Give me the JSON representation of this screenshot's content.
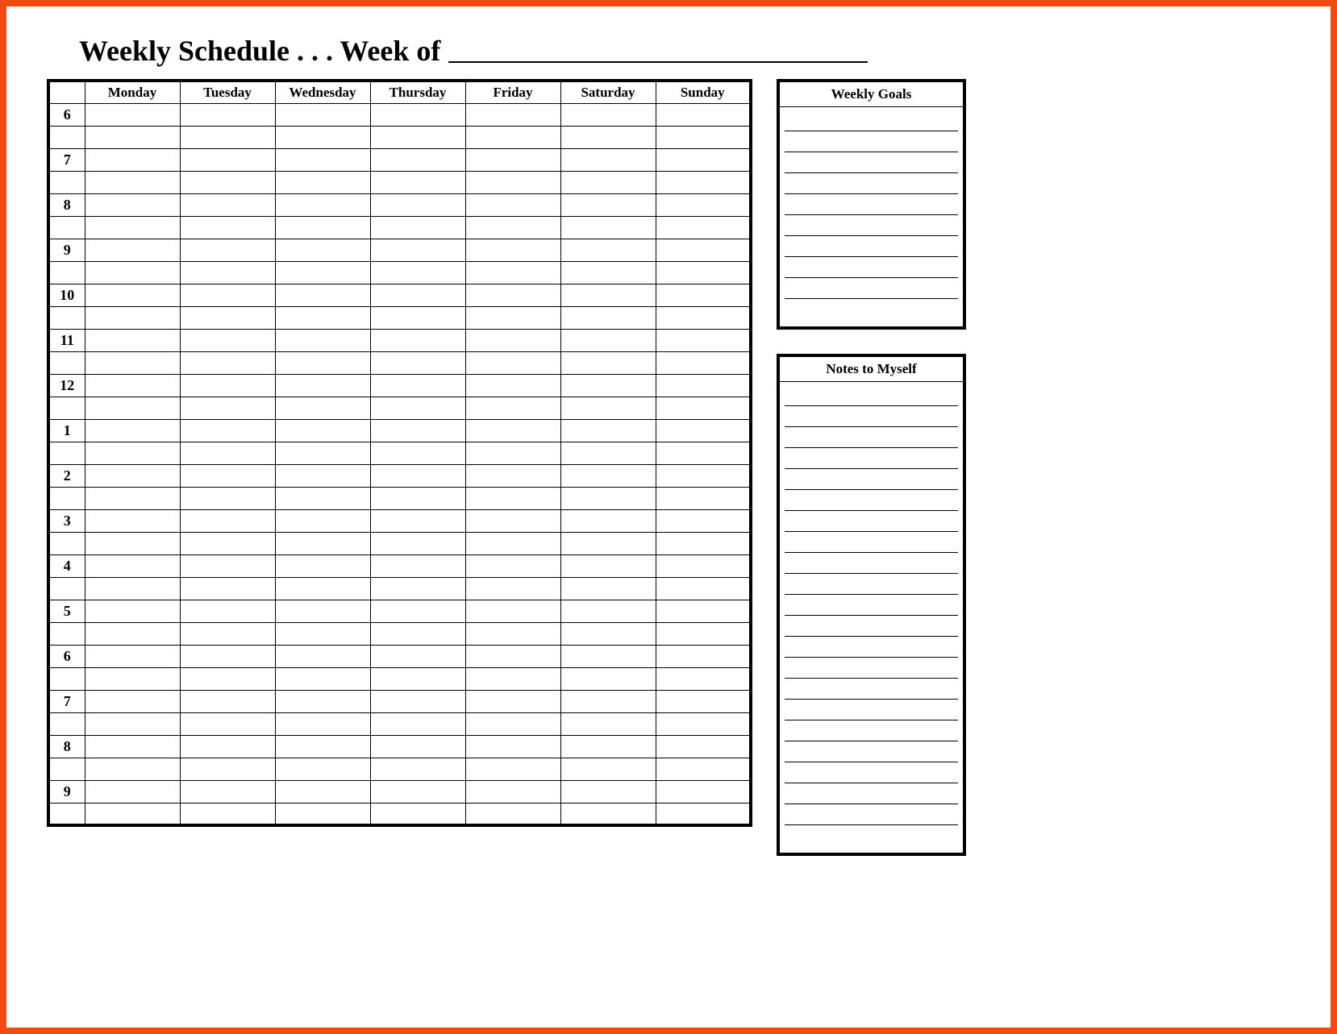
{
  "title": {
    "prefix": "Weekly Schedule . . . Week of",
    "week_of_value": ""
  },
  "schedule": {
    "days": [
      "Monday",
      "Tuesday",
      "Wednesday",
      "Thursday",
      "Friday",
      "Saturday",
      "Sunday"
    ],
    "hours": [
      "6",
      "7",
      "8",
      "9",
      "10",
      "11",
      "12",
      "1",
      "2",
      "3",
      "4",
      "5",
      "6",
      "7",
      "8",
      "9"
    ],
    "cells": []
  },
  "side": {
    "goals": {
      "title": "Weekly Goals",
      "line_count": 10,
      "lines": []
    },
    "notes": {
      "title": "Notes to Myself",
      "line_count": 22,
      "lines": []
    }
  }
}
